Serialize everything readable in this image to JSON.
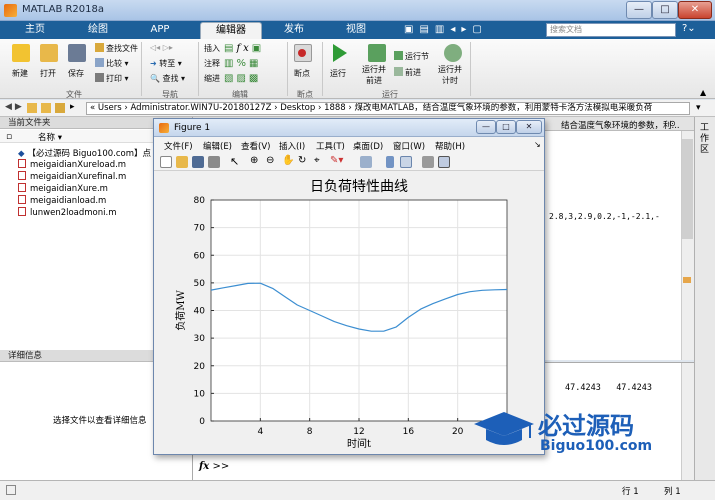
{
  "window": {
    "title": "MATLAB R2018a",
    "minimize": "—",
    "maximize": "□",
    "close": "✕"
  },
  "tabs": [
    {
      "label": "主页"
    },
    {
      "label": "绘图"
    },
    {
      "label": "APP"
    },
    {
      "label": "编辑器"
    },
    {
      "label": "发布"
    },
    {
      "label": "视图"
    }
  ],
  "search": {
    "placeholder": "搜索文档"
  },
  "ribbon": {
    "new": "新建",
    "open": "打开",
    "save": "保存",
    "find_files": "查找文件",
    "compare": "比较",
    "print": "打印",
    "file_group": "文件",
    "goto": "转至",
    "find": "查找",
    "nav_group": "导航",
    "insert": "插入",
    "comment": "注释",
    "indent": "缩进",
    "fx": "fx",
    "edit_group": "编辑",
    "breakpoint": "断点",
    "bp_group": "断点",
    "run": "运行",
    "run_advance_1": "运行并",
    "run_advance_2": "前进",
    "run_section": "运行节",
    "advance": "前进",
    "run_time_1": "运行并",
    "run_time_2": "计时",
    "run_group": "运行"
  },
  "address": {
    "path": "« Users › Administrator.WIN7U-20180127Z › Desktop › 1888 › 煤改电MATLAB，结合温度气象环境的参数，利用蒙特卡洛方法模拟电采暖负荷"
  },
  "left_panel": {
    "header": "当前文件夹",
    "col_name": "名称",
    "files": [
      "【必过源码 Biguo100.com】点",
      "meigaidianXureload.m",
      "meigaidianXurefinal.m",
      "meigaidianXure.m",
      "meigaidianload.m",
      "lunwen2loadmoni.m"
    ],
    "details_header": "详细信息",
    "details_text": "选择文件以查看详细信息"
  },
  "editor": {
    "header_snippet": "结合温度气象环境的参数，利...",
    "code_snippet": "2.8,3,2.9,0.2,-1,-2.1,-"
  },
  "command": {
    "values": [
      "47.4243",
      "47.4243"
    ],
    "prompt": ">>",
    "fx": "fx"
  },
  "workspace_label": "工作区",
  "status": {
    "row_label": "行",
    "row": "1",
    "col_label": "列",
    "col": "1"
  },
  "figure": {
    "title": "Figure 1",
    "menu": [
      "文件(F)",
      "编辑(E)",
      "查看(V)",
      "插入(I)",
      "工具(T)",
      "桌面(D)",
      "窗口(W)",
      "帮助(H)"
    ]
  },
  "chart_data": {
    "type": "line",
    "title": "日负荷特性曲线",
    "xlabel": "时间t",
    "ylabel": "负荷MW",
    "xlim": [
      0,
      24
    ],
    "ylim": [
      0,
      80
    ],
    "xticks": [
      4,
      8,
      12,
      16,
      20
    ],
    "yticks": [
      0,
      10,
      20,
      30,
      40,
      50,
      60,
      70,
      80
    ],
    "grid": true,
    "series": [
      {
        "color": "#3c8ed1",
        "x": [
          0,
          1,
          2,
          3,
          4,
          5,
          6,
          7,
          8,
          9,
          10,
          11,
          12,
          13,
          14,
          15,
          16,
          17,
          18,
          19,
          20,
          21,
          22,
          23,
          24
        ],
        "y": [
          47.4,
          48.2,
          49.0,
          49.8,
          49.9,
          48.0,
          45.0,
          42.0,
          40.0,
          38.0,
          36.0,
          34.5,
          33.3,
          32.5,
          32.5,
          34.0,
          37.5,
          40.5,
          42.5,
          44.2,
          45.8,
          46.8,
          47.3,
          47.5,
          47.6
        ]
      }
    ]
  },
  "watermark": {
    "brand": "必过源码",
    "url": "Biguo100.com"
  }
}
